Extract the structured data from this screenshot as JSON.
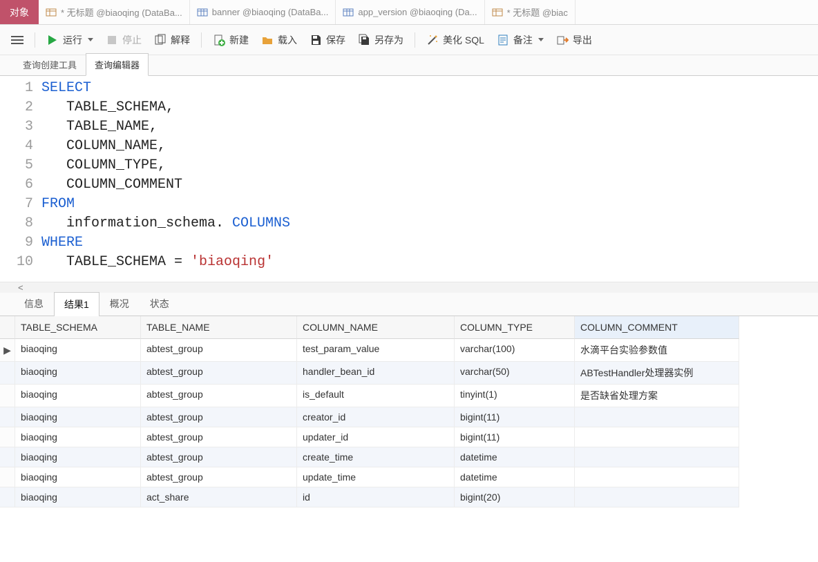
{
  "topTabs": {
    "objects": "对象",
    "items": [
      "* 无标题 @biaoqing (DataBa...",
      "banner @biaoqing (DataBa...",
      "app_version @biaoqing (Da...",
      "* 无标题 @biac"
    ]
  },
  "toolbar": {
    "run": "运行",
    "stop": "停止",
    "explain": "解释",
    "new": "新建",
    "load": "载入",
    "save": "保存",
    "saveAs": "另存为",
    "beautify": "美化 SQL",
    "notes": "备注",
    "export": "导出"
  },
  "subtabs": {
    "builder": "查询创建工具",
    "editor": "查询编辑器"
  },
  "sql": {
    "lines": [
      {
        "n": 1,
        "segments": [
          {
            "t": "SELECT",
            "c": "kw"
          }
        ]
      },
      {
        "n": 2,
        "segments": [
          {
            "t": "   TABLE_SCHEMA,",
            "c": ""
          }
        ]
      },
      {
        "n": 3,
        "segments": [
          {
            "t": "   TABLE_NAME,",
            "c": ""
          }
        ]
      },
      {
        "n": 4,
        "segments": [
          {
            "t": "   COLUMN_NAME,",
            "c": ""
          }
        ]
      },
      {
        "n": 5,
        "segments": [
          {
            "t": "   COLUMN_TYPE,",
            "c": ""
          }
        ]
      },
      {
        "n": 6,
        "segments": [
          {
            "t": "   COLUMN_COMMENT",
            "c": ""
          }
        ]
      },
      {
        "n": 7,
        "segments": [
          {
            "t": "FROM",
            "c": "kw"
          }
        ]
      },
      {
        "n": 8,
        "segments": [
          {
            "t": "   information_schema. ",
            "c": ""
          },
          {
            "t": "COLUMNS",
            "c": "ident"
          }
        ]
      },
      {
        "n": 9,
        "segments": [
          {
            "t": "WHERE",
            "c": "kw"
          }
        ]
      },
      {
        "n": 10,
        "segments": [
          {
            "t": "   TABLE_SCHEMA = ",
            "c": ""
          },
          {
            "t": "'biaoqing'",
            "c": "str"
          }
        ]
      }
    ]
  },
  "hscrollGlyph": "<",
  "resultTabs": {
    "info": "信息",
    "result1": "结果1",
    "profile": "概况",
    "status": "状态"
  },
  "columns": [
    "TABLE_SCHEMA",
    "TABLE_NAME",
    "COLUMN_NAME",
    "COLUMN_TYPE",
    "COLUMN_COMMENT"
  ],
  "rows": [
    {
      "schema": "biaoqing",
      "table": "abtest_group",
      "col": "test_param_value",
      "type": "varchar(100)",
      "comment": "水滴平台实验参数值"
    },
    {
      "schema": "biaoqing",
      "table": "abtest_group",
      "col": "handler_bean_id",
      "type": "varchar(50)",
      "comment": "ABTestHandler处理器实例"
    },
    {
      "schema": "biaoqing",
      "table": "abtest_group",
      "col": "is_default",
      "type": "tinyint(1)",
      "comment": "是否缺省处理方案"
    },
    {
      "schema": "biaoqing",
      "table": "abtest_group",
      "col": "creator_id",
      "type": "bigint(11)",
      "comment": ""
    },
    {
      "schema": "biaoqing",
      "table": "abtest_group",
      "col": "updater_id",
      "type": "bigint(11)",
      "comment": ""
    },
    {
      "schema": "biaoqing",
      "table": "abtest_group",
      "col": "create_time",
      "type": "datetime",
      "comment": ""
    },
    {
      "schema": "biaoqing",
      "table": "abtest_group",
      "col": "update_time",
      "type": "datetime",
      "comment": ""
    },
    {
      "schema": "biaoqing",
      "table": "act_share",
      "col": "id",
      "type": "bigint(20)",
      "comment": ""
    }
  ],
  "currentRowMarker": "▶"
}
